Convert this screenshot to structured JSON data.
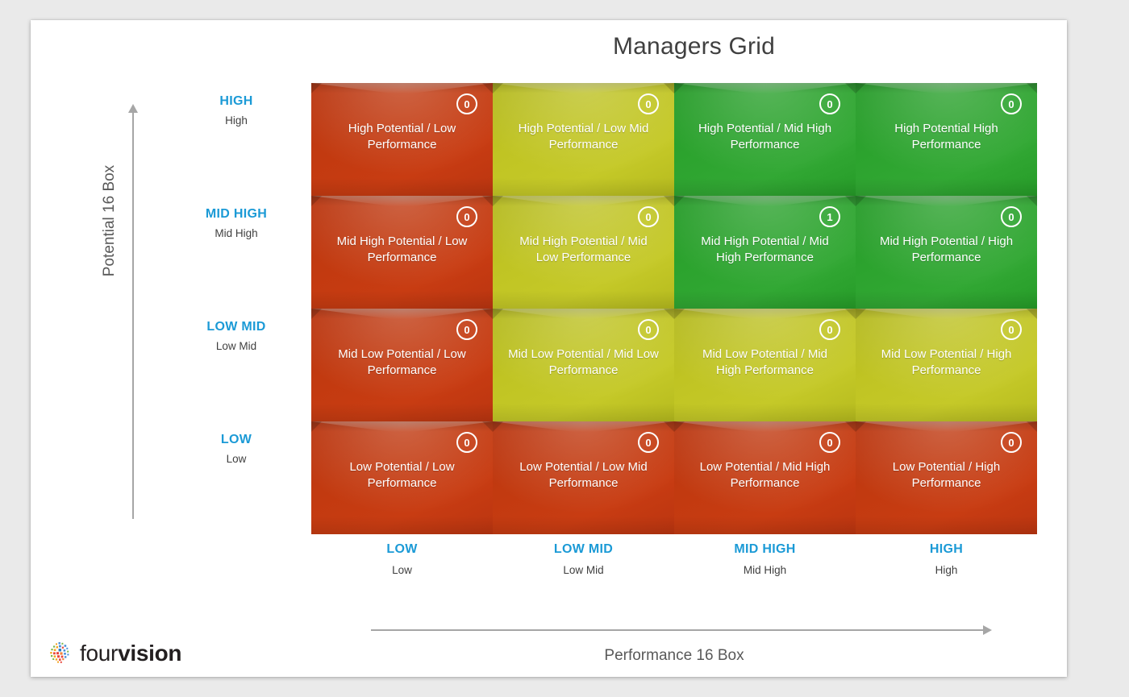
{
  "title": "Managers Grid",
  "colors": {
    "accent_label": "#1b9ad6",
    "red": "#c23a10",
    "yellow": "#c0c423",
    "green": "#2ca32e",
    "axis_gray": "#a6a6a6",
    "text_gray": "#595959"
  },
  "y_axis": {
    "title": "Potential 16 Box",
    "ticks": [
      {
        "main": "HIGH",
        "sub": "High"
      },
      {
        "main": "MID HIGH",
        "sub": "Mid High"
      },
      {
        "main": "LOW MID",
        "sub": "Low Mid"
      },
      {
        "main": "LOW",
        "sub": "Low"
      }
    ]
  },
  "x_axis": {
    "title": "Performance 16 Box",
    "ticks": [
      {
        "main": "LOW",
        "sub": "Low"
      },
      {
        "main": "LOW MID",
        "sub": "Low Mid"
      },
      {
        "main": "MID HIGH",
        "sub": "Mid High"
      },
      {
        "main": "HIGH",
        "sub": "High"
      }
    ]
  },
  "logo": {
    "text_light": "four",
    "text_bold": "vision",
    "mark_name": "fourvision-dot-cluster-logo"
  },
  "chart_data": {
    "type": "heatmap",
    "title": "Managers Grid",
    "xlabel": "Performance 16 Box",
    "ylabel": "Potential 16 Box",
    "x_categories": [
      "LOW",
      "LOW MID",
      "MID HIGH",
      "HIGH"
    ],
    "y_categories": [
      "HIGH",
      "MID HIGH",
      "LOW MID",
      "LOW"
    ],
    "grid": false,
    "legend": "none",
    "value_label": "count",
    "cells": [
      {
        "row": 0,
        "col": 0,
        "label": "High Potential / Low Performance",
        "count": "0",
        "color": "red"
      },
      {
        "row": 0,
        "col": 1,
        "label": "High Potential / Low Mid Performance",
        "count": "0",
        "color": "yellow"
      },
      {
        "row": 0,
        "col": 2,
        "label": "High Potential / Mid High Performance",
        "count": "0",
        "color": "green"
      },
      {
        "row": 0,
        "col": 3,
        "label": "High Potential High Performance",
        "count": "0",
        "color": "green"
      },
      {
        "row": 1,
        "col": 0,
        "label": "Mid High Potential / Low Performance",
        "count": "0",
        "color": "red"
      },
      {
        "row": 1,
        "col": 1,
        "label": "Mid High Potential / Mid Low Performance",
        "count": "0",
        "color": "yellow"
      },
      {
        "row": 1,
        "col": 2,
        "label": "Mid High Potential / Mid High Performance",
        "count": "1",
        "color": "green"
      },
      {
        "row": 1,
        "col": 3,
        "label": "Mid High Potential / High Performance",
        "count": "0",
        "color": "green"
      },
      {
        "row": 2,
        "col": 0,
        "label": "Mid Low Potential / Low Performance",
        "count": "0",
        "color": "red"
      },
      {
        "row": 2,
        "col": 1,
        "label": "Mid Low Potential / Mid Low Performance",
        "count": "0",
        "color": "yellow"
      },
      {
        "row": 2,
        "col": 2,
        "label": "Mid Low Potential / Mid High Performance",
        "count": "0",
        "color": "yellow"
      },
      {
        "row": 2,
        "col": 3,
        "label": "Mid Low Potential / High Performance",
        "count": "0",
        "color": "yellow"
      },
      {
        "row": 3,
        "col": 0,
        "label": "Low Potential / Low Performance",
        "count": "0",
        "color": "red"
      },
      {
        "row": 3,
        "col": 1,
        "label": "Low Potential / Low Mid Performance",
        "count": "0",
        "color": "red"
      },
      {
        "row": 3,
        "col": 2,
        "label": "Low Potential / Mid High Performance",
        "count": "0",
        "color": "red"
      },
      {
        "row": 3,
        "col": 3,
        "label": "Low Potential / High Performance",
        "count": "0",
        "color": "red"
      }
    ]
  }
}
